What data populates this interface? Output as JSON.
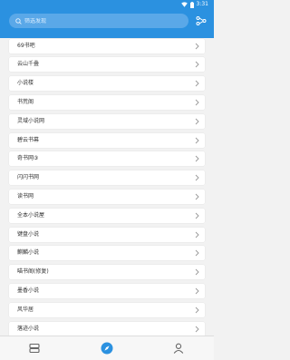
{
  "status": {
    "time": "3:31"
  },
  "search": {
    "placeholder": "筛选发现"
  },
  "sources": [
    "69书吧",
    "云山千叠",
    "小说楼",
    "书荒阁",
    "灵域小说网",
    "碧云书幕",
    "奇书网③",
    "闪闪书网",
    "读书网",
    "全本小说屋",
    "键盘小说",
    "麒麟小说",
    "喵书阁(修复)",
    "墨香小说",
    "风华居",
    "落迹小说"
  ],
  "colors": {
    "header": "#2b91e0",
    "accent": "#2b91e0",
    "background": "#f2f2f2"
  },
  "icons": {
    "search": "search-icon",
    "filter": "share-nodes-icon",
    "chevron": "chevron-right-icon",
    "nav_bookshelf": "bookshelf-icon",
    "nav_discover": "compass-icon",
    "nav_profile": "person-icon"
  }
}
